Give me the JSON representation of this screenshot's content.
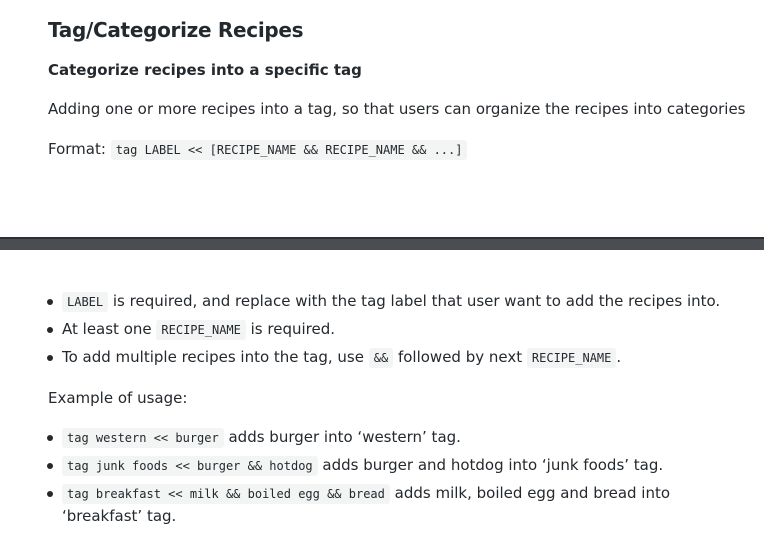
{
  "heading": "Tag/Categorize Recipes",
  "subheading": "Categorize recipes into a specific tag",
  "description": "Adding one or more recipes into a tag, so that users can organize the recipes into categories",
  "format": {
    "label": "Format:",
    "code": "tag LABEL << [RECIPE_NAME && RECIPE_NAME && ...]"
  },
  "requirements": [
    {
      "code": "LABEL",
      "text": " is required, and replace with the tag label that user want to add the recipes into."
    },
    {
      "pre": "At least one ",
      "code": "RECIPE_NAME",
      "text": " is required."
    },
    {
      "pre": "To add multiple recipes into the tag, use ",
      "code": "&&",
      "mid": " followed by next ",
      "code2": "RECIPE_NAME",
      "text": "."
    }
  ],
  "usage_label": "Example of usage:",
  "examples": [
    {
      "code": "tag western << burger",
      "text": " adds burger into ‘western’ tag."
    },
    {
      "code": "tag junk foods << burger && hotdog",
      "text": " adds burger and hotdog into ‘junk foods’ tag."
    },
    {
      "code": "tag breakfast << milk && boiled egg && bread",
      "text": " adds milk, boiled egg and bread into",
      "text2": "‘breakfast’ tag."
    }
  ]
}
